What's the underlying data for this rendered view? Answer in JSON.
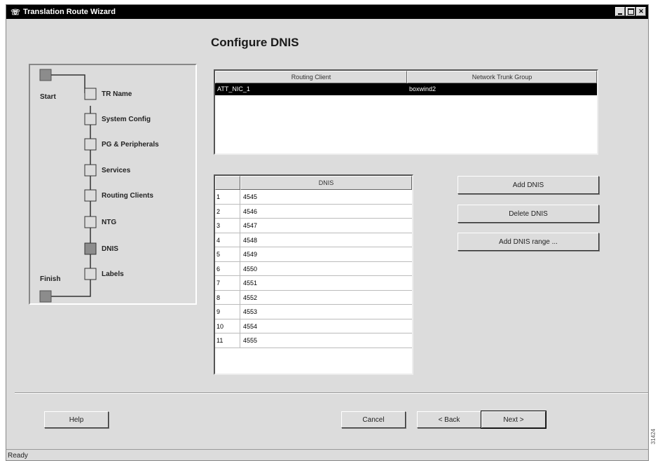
{
  "window": {
    "title": "Translation Route Wizard"
  },
  "page_title": "Configure DNIS",
  "steps": {
    "start": "Start",
    "finish": "Finish",
    "items": [
      {
        "label": "TR Name",
        "active": false
      },
      {
        "label": "System Config",
        "active": false
      },
      {
        "label": "PG & Peripherals",
        "active": false
      },
      {
        "label": "Services",
        "active": false
      },
      {
        "label": "Routing Clients",
        "active": false
      },
      {
        "label": "NTG",
        "active": false
      },
      {
        "label": "DNIS",
        "active": true
      },
      {
        "label": "Labels",
        "active": false
      }
    ]
  },
  "routing_table": {
    "columns": [
      "Routing Client",
      "Network Trunk Group"
    ],
    "rows": [
      [
        "ATT_NIC_1",
        "boxwind2"
      ]
    ]
  },
  "dnis_table": {
    "column": "DNIS",
    "rows": [
      {
        "n": "1",
        "v": "4545"
      },
      {
        "n": "2",
        "v": "4546"
      },
      {
        "n": "3",
        "v": "4547"
      },
      {
        "n": "4",
        "v": "4548"
      },
      {
        "n": "5",
        "v": "4549"
      },
      {
        "n": "6",
        "v": "4550"
      },
      {
        "n": "7",
        "v": "4551"
      },
      {
        "n": "8",
        "v": "4552"
      },
      {
        "n": "9",
        "v": "4553"
      },
      {
        "n": "10",
        "v": "4554"
      },
      {
        "n": "11",
        "v": "4555"
      }
    ]
  },
  "buttons": {
    "add_dnis": "Add DNIS",
    "delete_dnis": "Delete DNIS",
    "add_dnis_range": "Add DNIS range ...",
    "help": "Help",
    "cancel": "Cancel",
    "back": "< Back",
    "next": "Next >"
  },
  "status": "Ready",
  "figure_ref": "31424",
  "colors": {
    "active_step": "#8c8c8c",
    "selection": "#000000",
    "dialog_bg": "#dcdcdc"
  },
  "icons": {
    "app": "phone-icon",
    "minimize": "minimize-icon",
    "maximize": "maximize-icon",
    "close": "close-icon"
  }
}
